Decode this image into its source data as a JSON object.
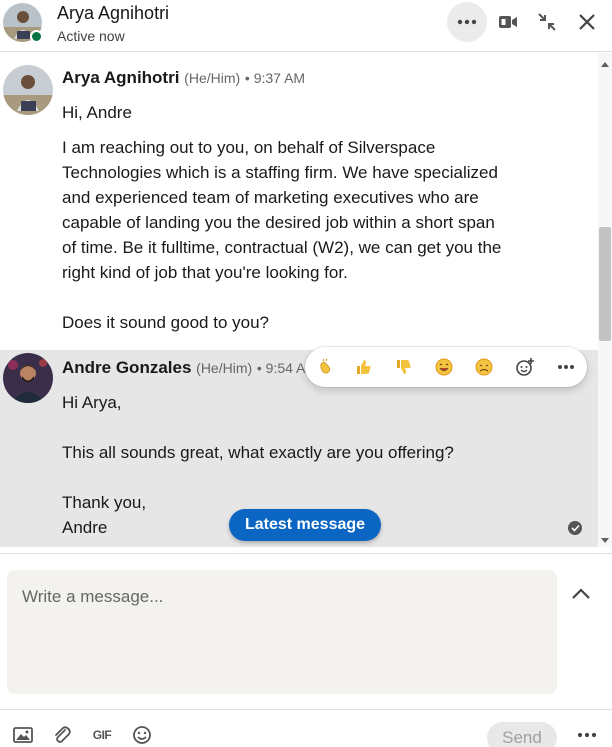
{
  "header": {
    "name": "Arya Agnihotri",
    "status": "Active now"
  },
  "messages": [
    {
      "sender": "Arya Agnihotri",
      "pronouns": "(He/Him)",
      "time": "• 9:37 AM",
      "lines": [
        "Hi, Andre",
        "I am reaching out to you, on behalf of Silverspace",
        "Technologies which is a staffing firm. We have specialized",
        "and experienced team of marketing executives who are",
        "capable of landing you the desired job within a short span",
        "of time. Be it fulltime, contractual (W2), we can get you the",
        "right kind of job that you're looking for.",
        "Does it sound good to you?"
      ]
    },
    {
      "sender": "Andre Gonzales",
      "pronouns": "(He/Him)",
      "time": "• 9:54 A",
      "lines": [
        "Hi Arya,",
        "This all sounds great, what exactly are you offering?",
        "Thank you,",
        "Andre"
      ]
    }
  ],
  "reactions": [
    "clapping-icon",
    "thumbs-up-icon",
    "thumbs-down-icon",
    "smile-icon",
    "sad-icon",
    "add-reaction-icon",
    "more-icon"
  ],
  "latest_message_label": "Latest message",
  "compose": {
    "placeholder": "Write a message...",
    "send_label": "Send",
    "gif_label": "GIF"
  },
  "colors": {
    "accent": "#0a66c2",
    "presence": "#057642",
    "highlight": "#e6e6e6",
    "compose_bg": "#f4f2ee"
  }
}
